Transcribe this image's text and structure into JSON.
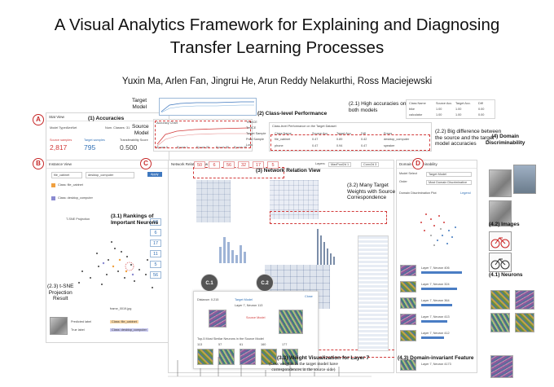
{
  "paper": {
    "title_line1": "A Visual Analytics Framework for Explaining and Diagnosing",
    "title_line2": "Transfer Learning Processes",
    "authors": "Yuxin Ma, Arlen Fan, Jingrui He, Arun Reddy Nelakurthi, Ross Maciejewski"
  },
  "markers": {
    "a": "A",
    "b": "B",
    "c": "C",
    "d": "D",
    "c1": "C.1",
    "c2": "C.2"
  },
  "annotations": {
    "accuracies": "(1) Accuracies",
    "target_model": "Target\nModel",
    "source_model": "Source\nModel",
    "class_level": "(2) Class-level Performance",
    "high_acc": "(2.1) High accuracies on\nboth models",
    "big_diff": "(2.2) Big difference between\nthe source and the target\nmodel accuracies",
    "domain_disc": "(4) Domain\nDiscriminability",
    "rankings": "(3.1) Rankings of\nImportant Neurons",
    "network_view": "(3) Network Relation View",
    "many_target": "(3.2) Many Target\nWeights with Source\nCorrespondence",
    "images": "(4.2) Images",
    "tsne": "(2.3) t-SNE\nProjection\nResult",
    "neurons": "(4.1) Neurons",
    "weight_vis": "(3.3) Weight Visualization for Layer 7",
    "weight_vis_sub": "(Less weights in the target model have\ncorrespondences in the source side)",
    "domain_invariant": "(4.3) Domain-invariant Feature"
  },
  "stat_view": {
    "title": "Stat View",
    "model_type_label": "Model Type:",
    "model_type": "AlexNet",
    "num_classes_label": "Num. Classes:",
    "num_classes": "31",
    "source_label": "Source samples",
    "target_label": "Target samples",
    "transfer_label": "Transferability Score",
    "source_count": "2,817",
    "target_count": "795",
    "transfer_score": "0.500",
    "accuracy_title": "Accuracy Chart",
    "epochs": [
      "Epoch 0",
      "Epoch 1",
      "Epoch 20",
      "Epoch 30",
      "Epoch 40"
    ]
  },
  "class_perf": {
    "title": "Class-level Performance on the Target Dataset",
    "headers": [
      "Class Name",
      "Source Acc.",
      "Target Acc.",
      "Diff",
      "Errors"
    ],
    "rows": [
      [
        "file_cabinet",
        "0.47",
        "0.89",
        "0.42",
        "desktop_computer"
      ],
      [
        "phone",
        "0.47",
        "0.94",
        "0.47",
        "speaker"
      ]
    ],
    "small_headers": [
      "Class Name",
      "Source Acc.",
      "Target Acc.",
      "Diff"
    ],
    "small_rows": [
      [
        "bike",
        "1.00",
        "1.00",
        "0.00"
      ],
      [
        "calculator",
        "1.00",
        "1.00",
        "0.00"
      ]
    ],
    "legend": [
      "TrainCE",
      "TestCE",
      "Target Sample",
      "Pred Sample",
      "Loss"
    ]
  },
  "instance_view": {
    "title": "Instance View",
    "select1": "file_cabinet",
    "select2": "desktop_computer",
    "apply": "Apply",
    "class1": "Class: file_cabinet",
    "class2": "Class: desktop_computer",
    "tsne_title": "T-SNE Projection",
    "pred_label": "Predicted label",
    "true_label": "True label",
    "frame": "frame_0019.jpg"
  },
  "network_view": {
    "title": "Network Relation View",
    "layer_label": "Layers:",
    "layer_value": "MaxPool2d 1",
    "conv_value": "Conv2d 3",
    "chips_top": [
      "50",
      "6",
      "56",
      "32",
      "17",
      "5"
    ],
    "chips_left": [
      "50",
      "6",
      "17",
      "11",
      "5",
      "56"
    ],
    "target_model": "Target Model",
    "source_model": "Source Model",
    "neuron_target": "Layer 7, Neuron 113",
    "distance": "Distance: 0.215",
    "close": "Close",
    "top5": "Top-5 Most Similar Neurons in the Source Model",
    "top5_ids": [
      "113",
      "57",
      "61",
      "160",
      "177"
    ]
  },
  "domain_view": {
    "title": "Domain Discriminability",
    "model_select": "Model Select",
    "model_value": "Target Model",
    "order": "Order",
    "order_value": "Most Domain Discriminative",
    "plot_title": "Domain Discrimination Plot",
    "legend": "Legend",
    "neurons": [
      "Layer 7, Neuron 406",
      "Layer 7, Neuron 324",
      "Layer 7, Neuron 364",
      "Layer 7, Neuron 413",
      "Layer 7, Neuron 412"
    ],
    "feature": "Layer 7, Neuron 4173"
  },
  "colors": {
    "accent_red": "#d23a3a",
    "accent_blue": "#2f6fb5"
  }
}
